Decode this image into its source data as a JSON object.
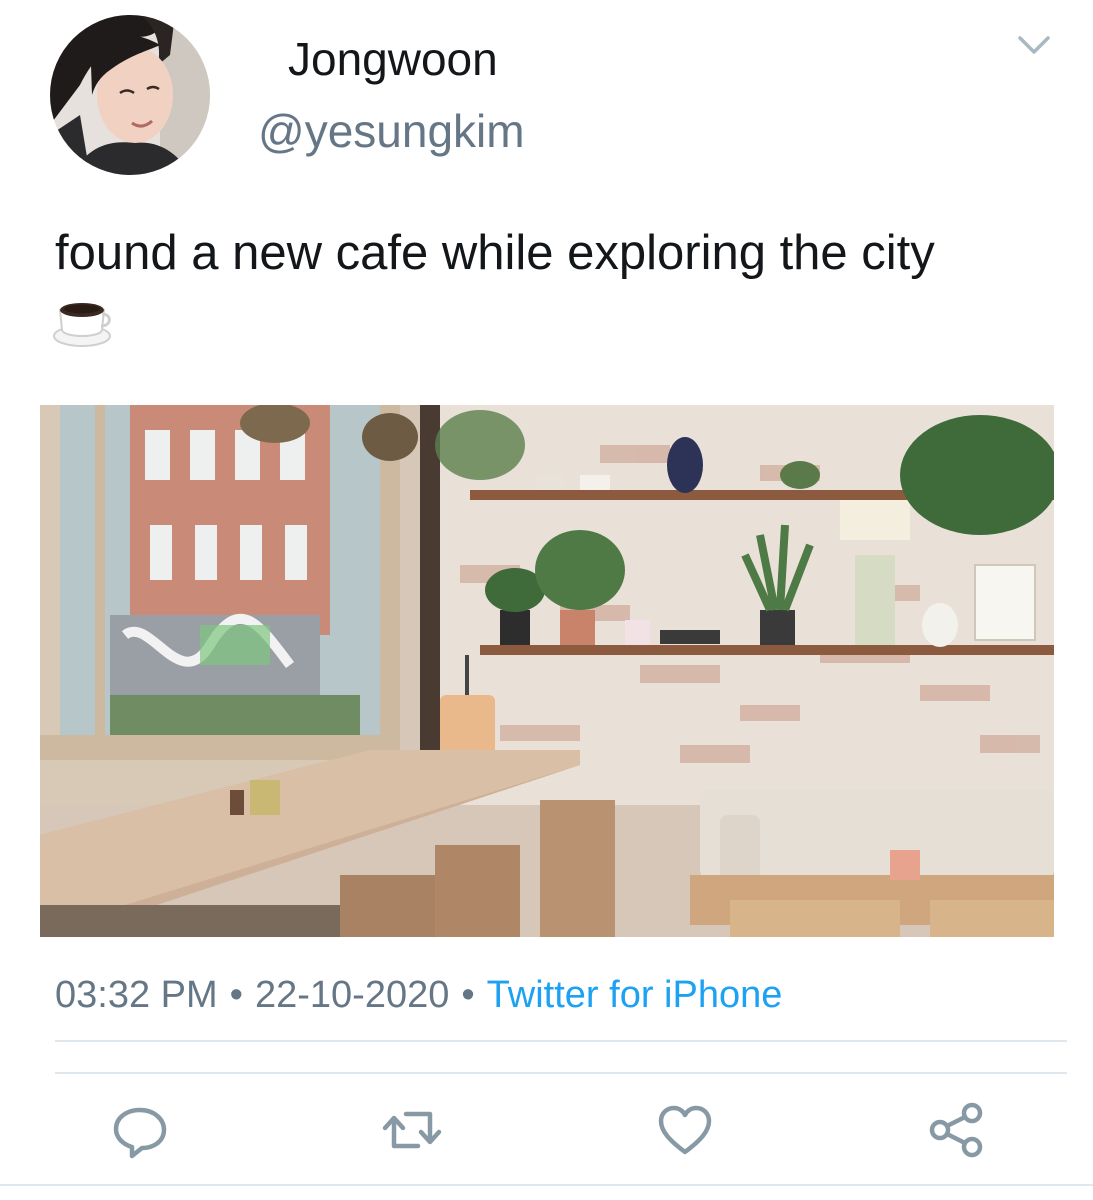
{
  "user": {
    "display_name": "Jongwoon",
    "handle": "@yesungkim"
  },
  "tweet": {
    "text": "found a new cafe while exploring the city",
    "emoji_icon": "hot-beverage-icon",
    "media_subject": "cafe interior photo"
  },
  "meta": {
    "time": "03:32 PM",
    "separator": "•",
    "date": "22-10-2020",
    "source": "Twitter for iPhone"
  },
  "actions": {
    "reply_icon": "reply-icon",
    "retweet_icon": "retweet-icon",
    "like_icon": "heart-icon",
    "share_icon": "share-icon"
  },
  "colors": {
    "text_primary": "#14171a",
    "text_secondary": "#657786",
    "accent": "#1da1f2",
    "divider": "#e1e8ed",
    "icon": "#8899a6"
  }
}
